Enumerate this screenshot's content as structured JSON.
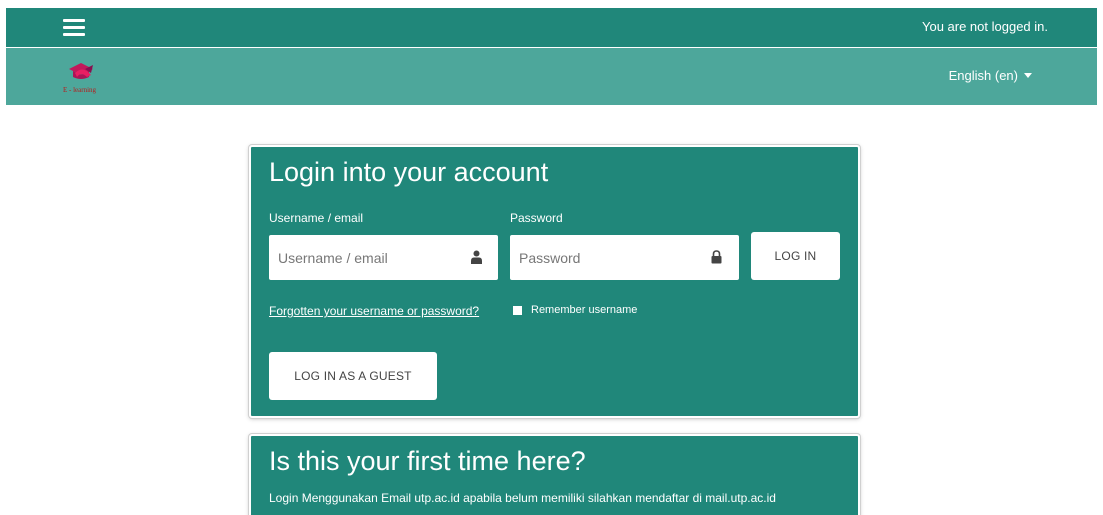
{
  "topbar": {
    "menu_icon": "hamburger-menu-icon",
    "login_status": "You are not logged in."
  },
  "subbar": {
    "logo_icon": "e-learning-logo",
    "language": "English (en)",
    "language_icon": "caret-down-icon"
  },
  "login_card": {
    "title": "Login into your account",
    "username_label": "Username / email",
    "username_placeholder": "Username / email",
    "username_icon": "user-icon",
    "password_label": "Password",
    "password_placeholder": "Password",
    "password_icon": "lock-icon",
    "login_button": "LOG IN",
    "forgot_link": "Forgotten your username or password?",
    "remember_label": "Remember username",
    "guest_button": "LOG IN AS A GUEST"
  },
  "first_time_card": {
    "title": "Is this your first time here?",
    "text": "Login Menggunakan Email utp.ac.id apabila belum memiliki silahkan mendaftar di mail.utp.ac.id"
  },
  "colors": {
    "primary": "#20877a",
    "secondary": "#4da79b"
  }
}
